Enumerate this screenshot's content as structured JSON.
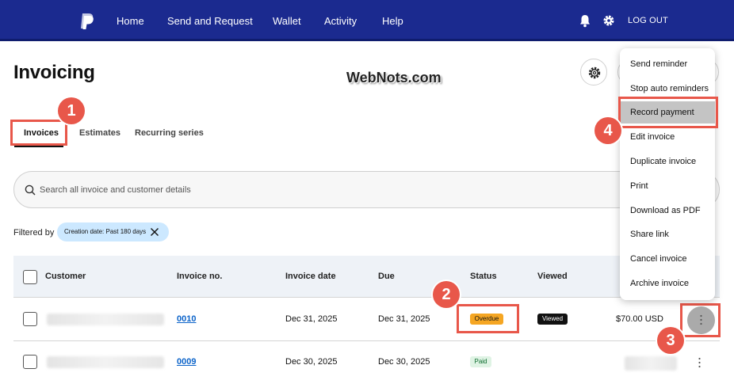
{
  "nav": {
    "items": [
      "Home",
      "Send and Request",
      "Wallet",
      "Activity",
      "Help"
    ],
    "logout": "LOG OUT"
  },
  "page": {
    "title": "Invoicing",
    "watermark": "WebNots.com"
  },
  "tabs": [
    "Invoices",
    "Estimates",
    "Recurring series"
  ],
  "search": {
    "placeholder": "Search all invoice and customer details"
  },
  "filter": {
    "label": "Filtered by",
    "chip": "Creation date: Past 180 days"
  },
  "table": {
    "headers": [
      "Customer",
      "Invoice no.",
      "Invoice date",
      "Due",
      "Status",
      "Viewed"
    ],
    "rows": [
      {
        "invoice_no": "0010",
        "invoice_date": "Dec 31, 2025",
        "due": "Dec 31, 2025",
        "status": "Overdue",
        "viewed": "Viewed",
        "amount": "$70.00 USD"
      },
      {
        "invoice_no": "0009",
        "invoice_date": "Dec 30, 2025",
        "due": "Dec 30, 2025",
        "status": "Paid",
        "viewed": "",
        "amount": ""
      }
    ]
  },
  "menu": {
    "items": [
      "Send reminder",
      "Stop auto reminders",
      "Record payment",
      "Edit invoice",
      "Duplicate invoice",
      "Print",
      "Download as PDF",
      "Share link",
      "Cancel invoice",
      "Archive invoice"
    ],
    "selected": "Record payment"
  },
  "annotations": [
    "1",
    "2",
    "3",
    "4"
  ],
  "colors": {
    "nav_bg": "#1b2a8f",
    "highlight": "#e8574a",
    "overdue": "#f5a623",
    "link": "#0b63c9"
  }
}
